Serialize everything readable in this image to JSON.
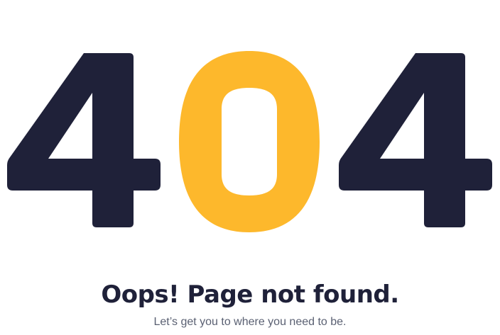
{
  "error": {
    "code_digits": [
      "4",
      "0",
      "4"
    ],
    "title": "Oops! Page not found.",
    "subtitle": "Let’s get you to where you need to be."
  },
  "colors": {
    "digit_dark": "#1f2139",
    "digit_accent": "#fdb82c",
    "title": "#1f2139",
    "subtitle": "#5a6072",
    "background": "#ffffff"
  }
}
